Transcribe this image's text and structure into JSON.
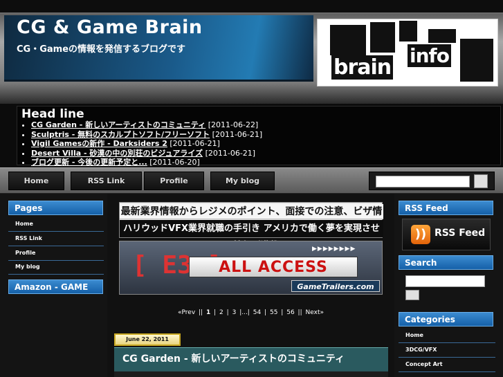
{
  "header": {
    "title": "CG & Game Brain",
    "subtitle": "CG・Gameの情報を発信するブログです",
    "logo_text_1": "brain",
    "logo_text_2": "info"
  },
  "headline": {
    "title": "Head line",
    "items": [
      {
        "link": "CG Garden - 新しいアーティストのコミュニティ",
        "date": "[2011-06-22]"
      },
      {
        "link": "Sculptris - 無料のスカルプトソフト/フリーソフト",
        "date": "[2011-06-21]"
      },
      {
        "link": "Vigil Gamesの新作 - Darksiders 2",
        "date": "[2011-06-21]"
      },
      {
        "link": "Desert Villa - 砂漠の中の別荘のビジュアライズ",
        "date": "[2011-06-21]"
      },
      {
        "link": "ブログ更新 - 今後の更新予定と...",
        "date": "[2011-06-20]"
      }
    ]
  },
  "nav": {
    "items": [
      "Home",
      "RSS Link",
      "Profile",
      "My blog"
    ],
    "search_placeholder": ""
  },
  "left_sidebar": {
    "pages_title": "Pages",
    "pages": [
      "Home",
      "RSS Link",
      "Profile",
      "My blog"
    ],
    "amazon_title": "Amazon - GAME"
  },
  "content": {
    "ad1_line1": "最新業界情報からレジメのポイント、面接での注意、ビザ情報まで",
    "ad1_line2": "ハリウッドVFX業界就職の手引き アメリカで働く夢を実現させる情報が満載",
    "ad2_e3": "[ E3 ]",
    "ad2_all": "ALL ACCESS",
    "ad2_arrows": "▶▶▶▶▶▶▶▶",
    "ad2_gt": "GameTrailers.com",
    "pager": [
      "«Prev",
      "||",
      "1",
      "|",
      "2",
      "|",
      "3",
      "|...|",
      "54",
      "|",
      "55",
      "|",
      "56",
      "||",
      "Next»"
    ],
    "post_date": "June 22, 2011",
    "post_title": "CG Garden - 新しいアーティストのコミュニティ"
  },
  "right_sidebar": {
    "rss_title": "RSS Feed",
    "rss_button_label": "RSS Feed",
    "rss_icon": "rss-icon",
    "search_title": "Search",
    "categories_title": "Categories",
    "categories": [
      "Home",
      "3DCG/VFX",
      "Concept Art",
      ""
    ]
  },
  "colors": {
    "accent_blue": "#1a6bb5",
    "post_title_bg": "#2a5a5f",
    "date_badge_border": "#c9a822"
  }
}
